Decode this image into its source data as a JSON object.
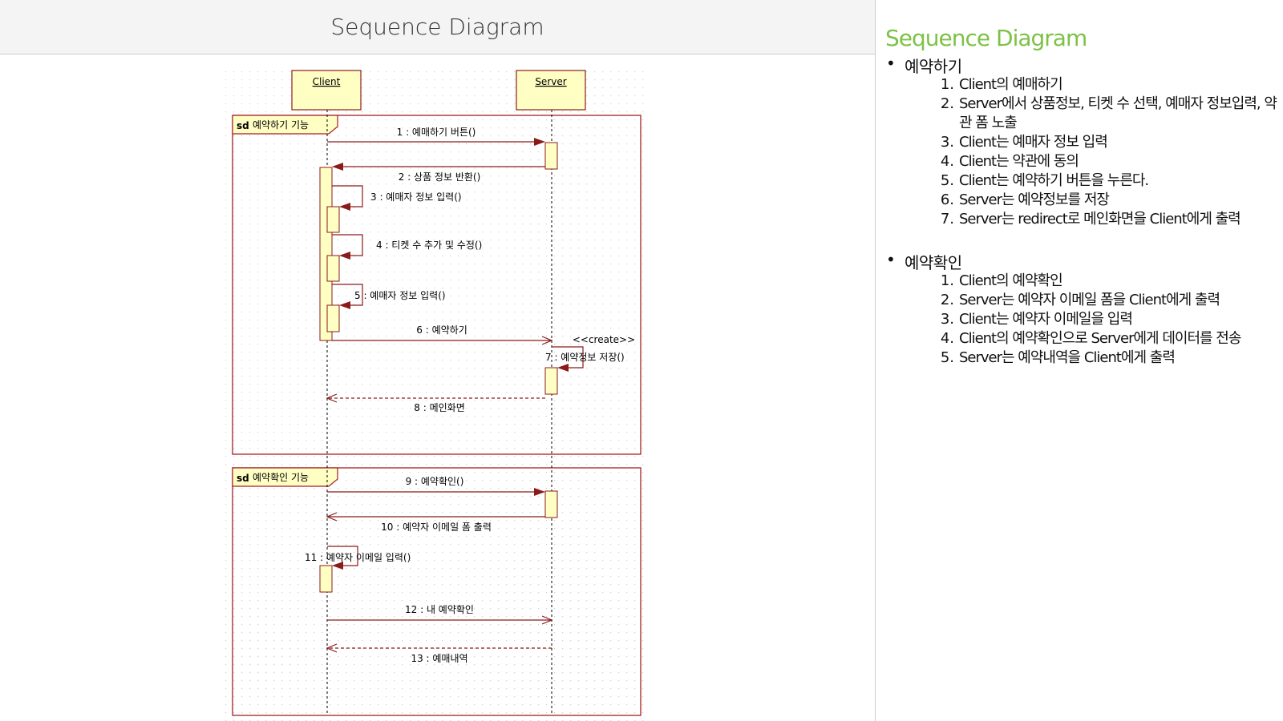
{
  "header": {
    "title": "Sequence Diagram"
  },
  "diagram": {
    "lifelines": [
      {
        "label": "Client"
      },
      {
        "label": "Server"
      }
    ],
    "frames": [
      {
        "keyword": "sd",
        "label": "예약하기 기능"
      },
      {
        "keyword": "sd",
        "label": "예약확인 기능"
      }
    ],
    "messages": [
      "1 : 예매하기 버튼()",
      "2 : 상품  정보 반환()",
      "3 : 예매자 정보 입력()",
      "4 : 티켓 수 추가 및 수정()",
      "5 : 예매자 정보 입력()",
      "6 : 예약하기",
      "7 : 예약정보 저장()",
      "8 : 메인화면",
      "9 : 예약확인()",
      "10 : 예약자 이메일 폼 출력",
      "11 : 예약자 이메일 입력()",
      "12 : 내 예약확인",
      "13 : 예매내역"
    ],
    "stereotype": "<<create>>",
    "colors": {
      "frame": "#a31f24",
      "message": "#8b1a1a",
      "activation_fill": "#ffffc4",
      "activation_stroke": "#8b1a1a",
      "grid": "#d2d2d2"
    }
  },
  "panel": {
    "title": "Sequence Diagram",
    "title_color": "#7dc246",
    "sections": [
      {
        "title": "예약하기",
        "steps": [
          "Client의 예매하기",
          "Server에서 상품정보, 티켓 수 선택, 예매자 정보입력, 약관 폼 노출",
          "Client는 예매자 정보 입력",
          "Client는 약관에 동의",
          "Client는 예약하기  버튼을 누른다.",
          "Server는 예약정보를 저장",
          "Server는 redirect로 메인화면을  Client에게 출력"
        ]
      },
      {
        "title": "예약확인",
        "steps": [
          "Client의 예약확인",
          "Server는 예약자 이메일 폼을 Client에게 출력",
          "Client는 예약자 이메일을 입력",
          "Client의 예약확인으로 Server에게 데이터를 전송",
          "Server는 예약내역을 Client에게 출력"
        ]
      }
    ]
  }
}
